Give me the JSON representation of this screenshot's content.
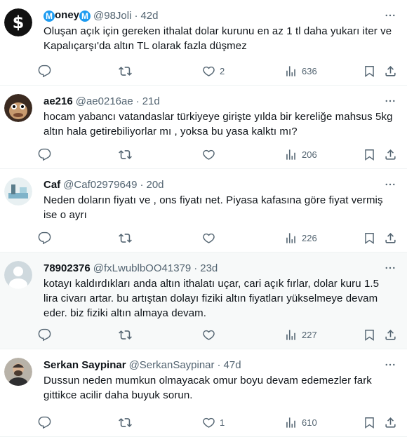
{
  "tweets": [
    {
      "name": "oney",
      "handle": "@98Joli",
      "time": "42d",
      "text": "Oluşan açık için gereken ithalat dolar kurunu en az 1 tl daha yukarı iter ve Kapalıçarşı'da altın TL olarak fazla düşmez",
      "replies": "",
      "retweets": "",
      "likes": "2",
      "views": "636"
    },
    {
      "name": "ae216",
      "handle": "@ae0216ae",
      "time": "21d",
      "text": "hocam yabancı vatandaslar türkiyeye girişte yılda bir kereliğe mahsus 5kg altın hala getirebiliyorlar mı , yoksa bu yasa kalktı mı?",
      "replies": "",
      "retweets": "",
      "likes": "",
      "views": "206"
    },
    {
      "name": "Caf",
      "handle": "@Caf02979649",
      "time": "20d",
      "text": "Neden doların fiyatı ve , ons fiyatı net. Piyasa kafasına göre fiyat vermiş ise o ayrı",
      "replies": "",
      "retweets": "",
      "likes": "",
      "views": "226"
    },
    {
      "name": "78902376",
      "handle": "@fxLwublbOO41379",
      "time": "23d",
      "text": "kotayı kaldırdıkları anda altın ithalatı uçar, cari açık fırlar, dolar kuru 1.5 lira civarı artar. bu artıştan dolayı fiziki altın fiyatları yükselmeye devam eder. biz fiziki altın almaya devam.",
      "replies": "",
      "retweets": "",
      "likes": "",
      "views": "227"
    },
    {
      "name": "Serkan Saypinar",
      "handle": "@SerkanSaypinar",
      "time": "47d",
      "text": "Dussun neden mumkun olmayacak omur boyu devam edemezler fark gittikce acilir daha buyuk sorun.",
      "replies": "",
      "retweets": "",
      "likes": "1",
      "views": "610"
    }
  ],
  "separator": "·",
  "verified_mark": "M",
  "icons": {
    "reply": "reply-icon",
    "retweet": "retweet-icon",
    "like": "heart-icon",
    "views": "views-icon",
    "bookmark": "bookmark-icon",
    "share": "share-icon",
    "more": "more-icon"
  },
  "colors": {
    "secondary_text": "#536471",
    "accent": "#1d9bf0",
    "hover_background": "#f7f9f9"
  }
}
